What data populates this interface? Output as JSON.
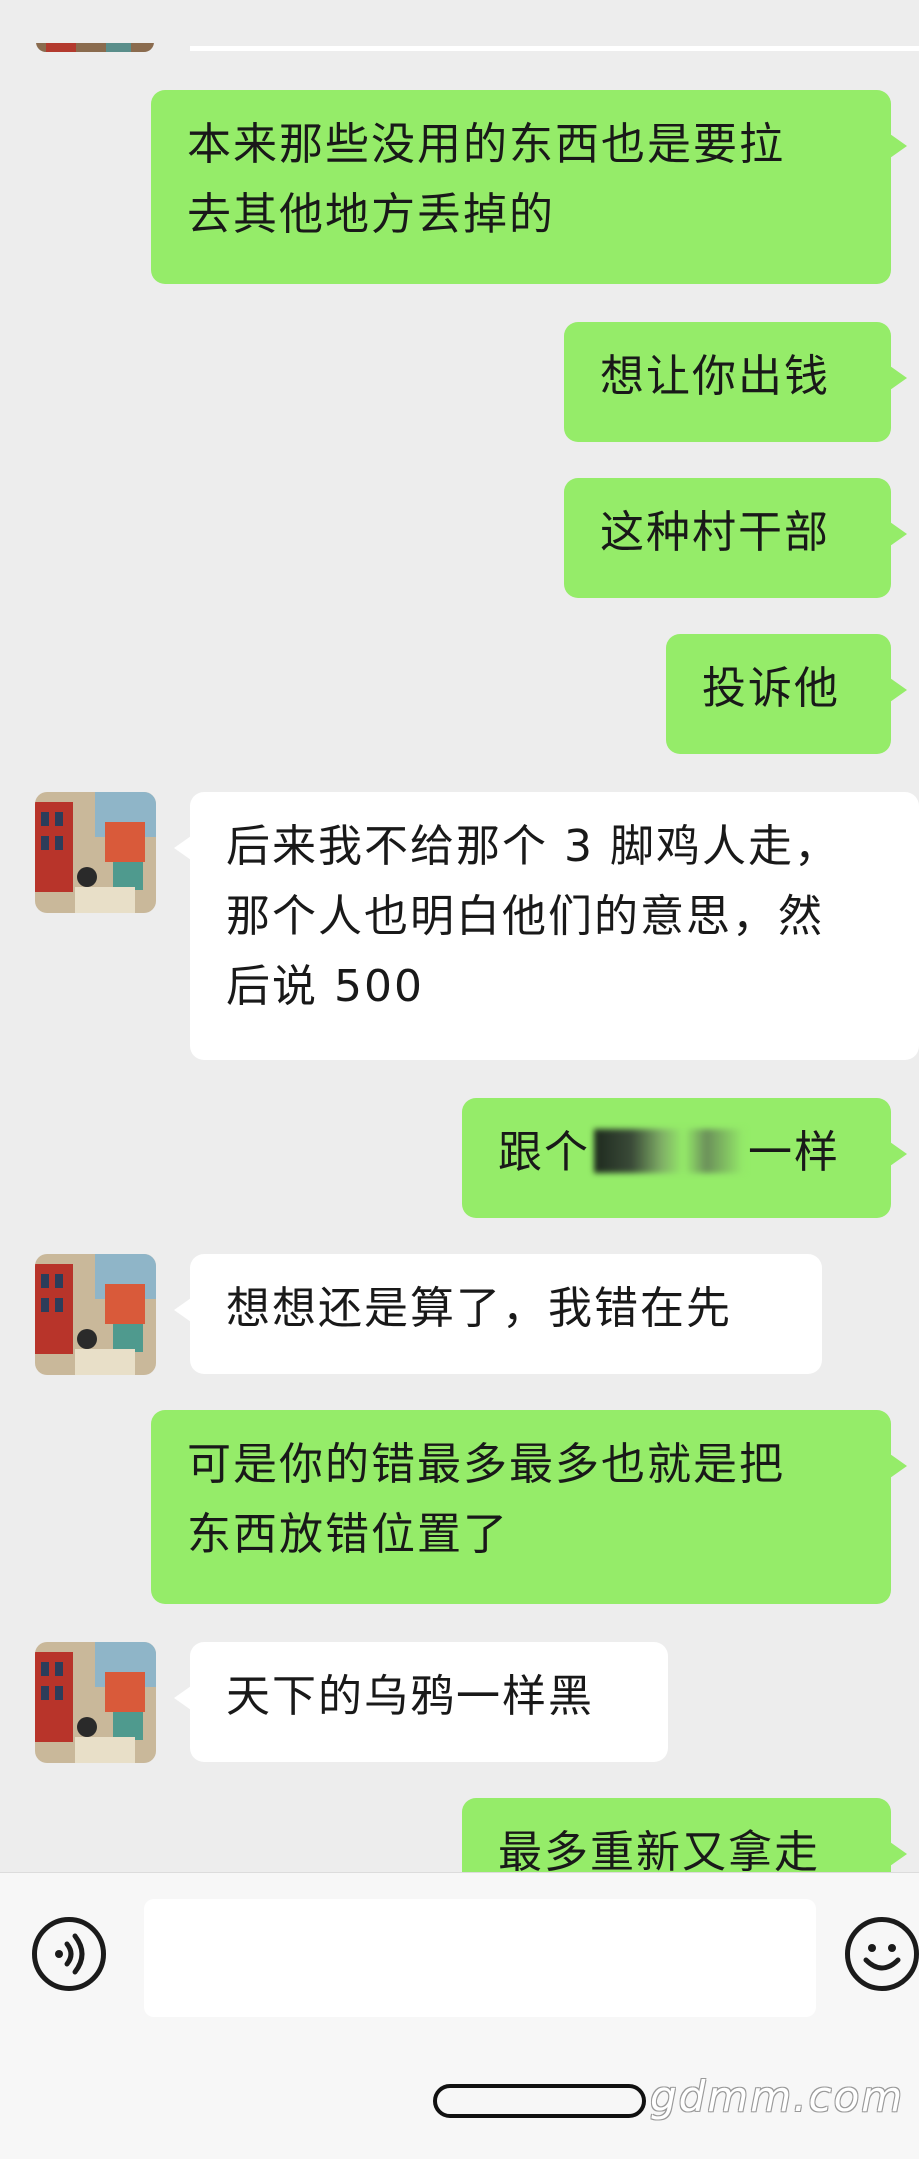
{
  "colors": {
    "background": "#ededed",
    "outgoing_bubble": "#95ec69",
    "incoming_bubble": "#ffffff",
    "text": "#191919"
  },
  "messages": [
    {
      "side": "out",
      "lines": [
        "本来那些没用的东西也是要拉",
        "去其他地方丢掉的"
      ]
    },
    {
      "side": "out",
      "lines": [
        "想让你出钱"
      ]
    },
    {
      "side": "out",
      "lines": [
        "这种村干部"
      ]
    },
    {
      "side": "out",
      "lines": [
        "投诉他"
      ]
    },
    {
      "side": "in",
      "lines": [
        "后来我不给那个 3 脚鸡人走，",
        "那个人也明白他们的意思，然",
        "后说 500"
      ]
    },
    {
      "side": "out",
      "text_before": "跟个",
      "text_after": "一样"
    },
    {
      "side": "in",
      "lines": [
        "想想还是算了，我错在先"
      ]
    },
    {
      "side": "out",
      "lines": [
        "可是你的错最多最多也就是把",
        "东西放错位置了"
      ]
    },
    {
      "side": "in",
      "lines": [
        "天下的乌鸦一样黑"
      ]
    },
    {
      "side": "out",
      "lines": [
        "最多重新又拿走"
      ]
    }
  ],
  "input_bar": {
    "voice_icon": "voice-icon",
    "emoji_icon": "emoji-icon",
    "input_value": ""
  },
  "watermark": "gdmm.com"
}
